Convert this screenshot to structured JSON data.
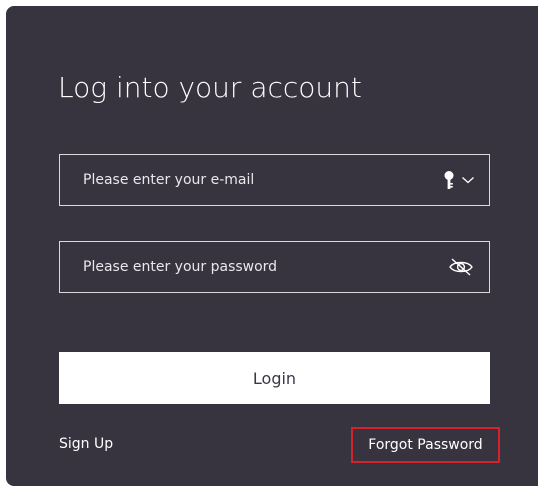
{
  "login_form": {
    "title": "Log into your account",
    "email": {
      "value": "",
      "placeholder": "Please enter your e-mail",
      "icons": [
        "key-icon",
        "chevron-down-icon"
      ]
    },
    "password": {
      "value": "",
      "placeholder": "Please enter your password",
      "icons": [
        "eye-slash-icon"
      ]
    },
    "login_label": "Login",
    "signup_label": "Sign Up",
    "forgot_label": "Forgot Password"
  },
  "colors": {
    "card_background": "#373440",
    "button_background": "#ffffff",
    "highlight_border": "#d4232d"
  }
}
